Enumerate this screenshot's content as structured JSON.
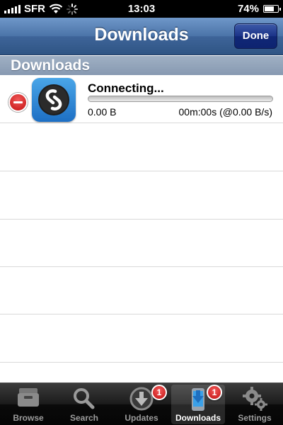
{
  "status_bar": {
    "carrier": "SFR",
    "time": "13:03",
    "battery_percent": "74%",
    "battery_level": 0.74
  },
  "nav": {
    "title": "Downloads",
    "done_label": "Done"
  },
  "section": {
    "title": "Downloads"
  },
  "download": {
    "title": "Connecting...",
    "size": "0.00 B",
    "eta": "00m:00s (@0.00 B/s)",
    "progress": 0,
    "app_icon": "shazam-icon"
  },
  "tabs": [
    {
      "label": "Browse",
      "icon": "archive-box-icon",
      "badge": ""
    },
    {
      "label": "Search",
      "icon": "magnifier-icon",
      "badge": ""
    },
    {
      "label": "Updates",
      "icon": "download-arrow-icon",
      "badge": "1"
    },
    {
      "label": "Downloads",
      "icon": "phone-download-icon",
      "badge": "1",
      "active": true
    },
    {
      "label": "Settings",
      "icon": "gears-icon",
      "badge": ""
    }
  ],
  "colors": {
    "nav_blue": "#4b74a8",
    "done_blue": "#1b3388",
    "badge_red": "#c21010",
    "progress_blue": "#3b7dd8"
  }
}
